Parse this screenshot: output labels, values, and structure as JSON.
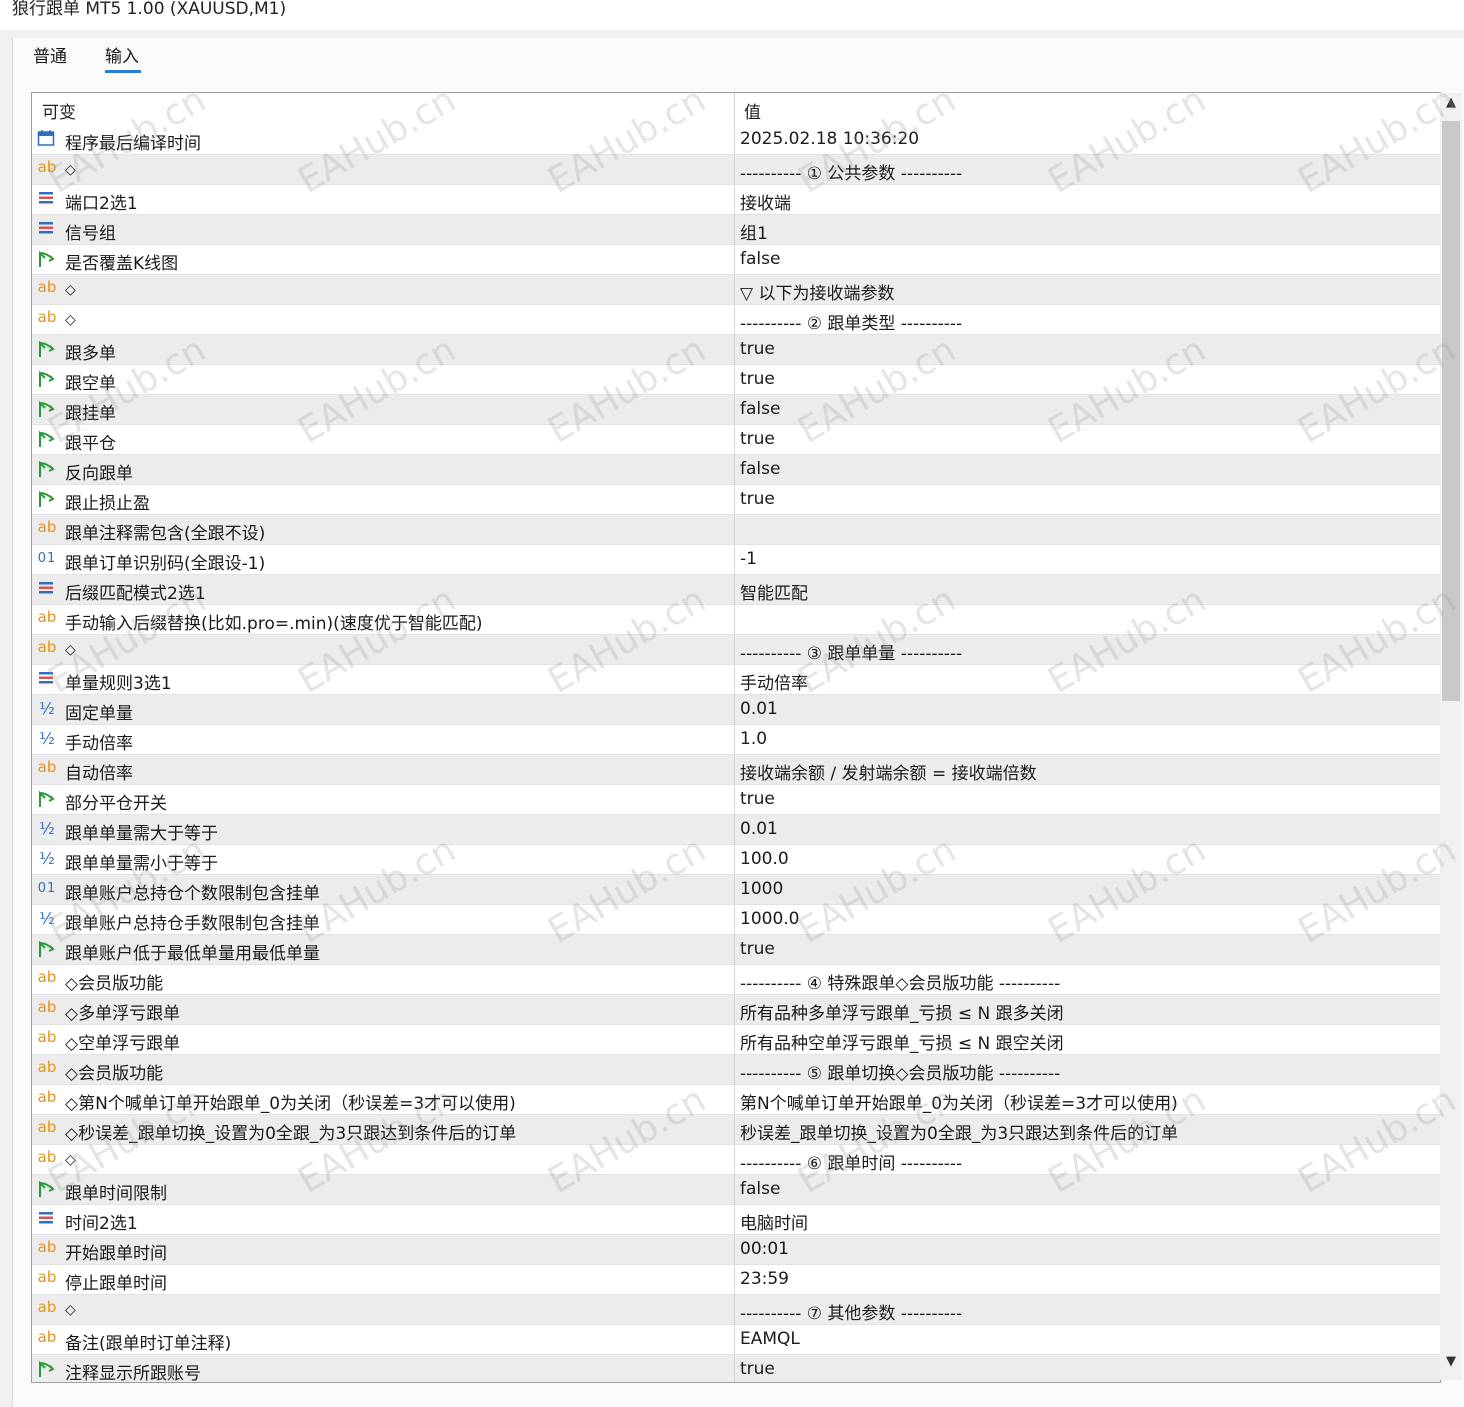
{
  "window": {
    "title": "狼行跟单 MT5 1.00 (XAUUSD,M1)"
  },
  "tabs": [
    {
      "label": "普通"
    },
    {
      "label": "输入"
    }
  ],
  "grid": {
    "header": {
      "col1": "可变",
      "col2": "值"
    },
    "rows": [
      {
        "icon": "calendar-icon",
        "name": "程序最后编译时间",
        "value": "2025.02.18 10:36:20"
      },
      {
        "icon": "ab",
        "name": "◇",
        "value": "---------- ① 公共参数 ----------"
      },
      {
        "icon": "enum",
        "name": "端口2选1",
        "value": "接收端"
      },
      {
        "icon": "enum",
        "name": "信号组",
        "value": "组1"
      },
      {
        "icon": "bool",
        "name": "是否覆盖K线图",
        "value": "false"
      },
      {
        "icon": "ab",
        "name": "◇",
        "value": "▽ 以下为接收端参数"
      },
      {
        "icon": "ab",
        "name": "◇",
        "value": "---------- ② 跟单类型 ----------"
      },
      {
        "icon": "bool",
        "name": "跟多单",
        "value": "true"
      },
      {
        "icon": "bool",
        "name": "跟空单",
        "value": "true"
      },
      {
        "icon": "bool",
        "name": "跟挂单",
        "value": "false"
      },
      {
        "icon": "bool",
        "name": "跟平仓",
        "value": "true"
      },
      {
        "icon": "bool",
        "name": "反向跟单",
        "value": "false"
      },
      {
        "icon": "bool",
        "name": "跟止损止盈",
        "value": "true"
      },
      {
        "icon": "ab",
        "name": "跟单注释需包含(全跟不设)",
        "value": ""
      },
      {
        "icon": "int",
        "name": "跟单订单识别码(全跟设-1)",
        "value": "-1"
      },
      {
        "icon": "enum",
        "name": "后缀匹配模式2选1",
        "value": "智能匹配"
      },
      {
        "icon": "ab",
        "name": "手动输入后缀替换(比如.pro=.min)(速度优于智能匹配)",
        "value": ""
      },
      {
        "icon": "ab",
        "name": "◇",
        "value": "---------- ③ 跟单单量 ----------"
      },
      {
        "icon": "enum",
        "name": "单量规则3选1",
        "value": "手动倍率"
      },
      {
        "icon": "double",
        "name": "固定单量",
        "value": "0.01"
      },
      {
        "icon": "double",
        "name": "手动倍率",
        "value": "1.0"
      },
      {
        "icon": "ab",
        "name": "自动倍率",
        "value": "接收端余额 / 发射端余额 = 接收端倍数"
      },
      {
        "icon": "bool",
        "name": "部分平仓开关",
        "value": "true"
      },
      {
        "icon": "double",
        "name": "跟单单量需大于等于",
        "value": "0.01"
      },
      {
        "icon": "double",
        "name": "跟单单量需小于等于",
        "value": "100.0"
      },
      {
        "icon": "int",
        "name": "跟单账户总持仓个数限制包含挂单",
        "value": "1000"
      },
      {
        "icon": "double",
        "name": "跟单账户总持仓手数限制包含挂单",
        "value": "1000.0"
      },
      {
        "icon": "bool",
        "name": "跟单账户低于最低单量用最低单量",
        "value": "true"
      },
      {
        "icon": "ab",
        "name": "◇会员版功能",
        "value": "---------- ④ 特殊跟单◇会员版功能 ----------"
      },
      {
        "icon": "ab",
        "name": "◇多单浮亏跟单",
        "value": "所有品种多单浮亏跟单_亏损 ≤ N 跟多关闭"
      },
      {
        "icon": "ab",
        "name": "◇空单浮亏跟单",
        "value": "所有品种空单浮亏跟单_亏损 ≤ N 跟空关闭"
      },
      {
        "icon": "ab",
        "name": "◇会员版功能",
        "value": "---------- ⑤ 跟单切换◇会员版功能 ----------"
      },
      {
        "icon": "ab",
        "name": "◇第N个喊单订单开始跟单_0为关闭（秒误差=3才可以使用)",
        "value": "第N个喊单订单开始跟单_0为关闭（秒误差=3才可以使用)"
      },
      {
        "icon": "ab",
        "name": "◇秒误差_跟单切换_设置为0全跟_为3只跟达到条件后的订单",
        "value": "秒误差_跟单切换_设置为0全跟_为3只跟达到条件后的订单"
      },
      {
        "icon": "ab",
        "name": "◇",
        "value": "---------- ⑥ 跟单时间 ----------"
      },
      {
        "icon": "bool",
        "name": "跟单时间限制",
        "value": "false"
      },
      {
        "icon": "enum",
        "name": "时间2选1",
        "value": "电脑时间"
      },
      {
        "icon": "ab",
        "name": "开始跟单时间",
        "value": "00:01"
      },
      {
        "icon": "ab",
        "name": "停止跟单时间",
        "value": "23:59"
      },
      {
        "icon": "ab",
        "name": "◇",
        "value": "---------- ⑦ 其他参数 ----------"
      },
      {
        "icon": "ab",
        "name": "备注(跟单时订单注释)",
        "value": "EAMQL"
      },
      {
        "icon": "bool",
        "name": "注释显示所跟账号",
        "value": "true"
      }
    ]
  },
  "watermark": {
    "text": "EAHub.cn"
  },
  "icons": {
    "ab": "ab",
    "int": "01",
    "double": "½",
    "scroll_up": "▲",
    "scroll_down": "▼"
  },
  "colors": {
    "ab_icon": "#e3941a",
    "blue_icon": "#2e6fbf",
    "tab_underline": "#2b7cd3"
  }
}
